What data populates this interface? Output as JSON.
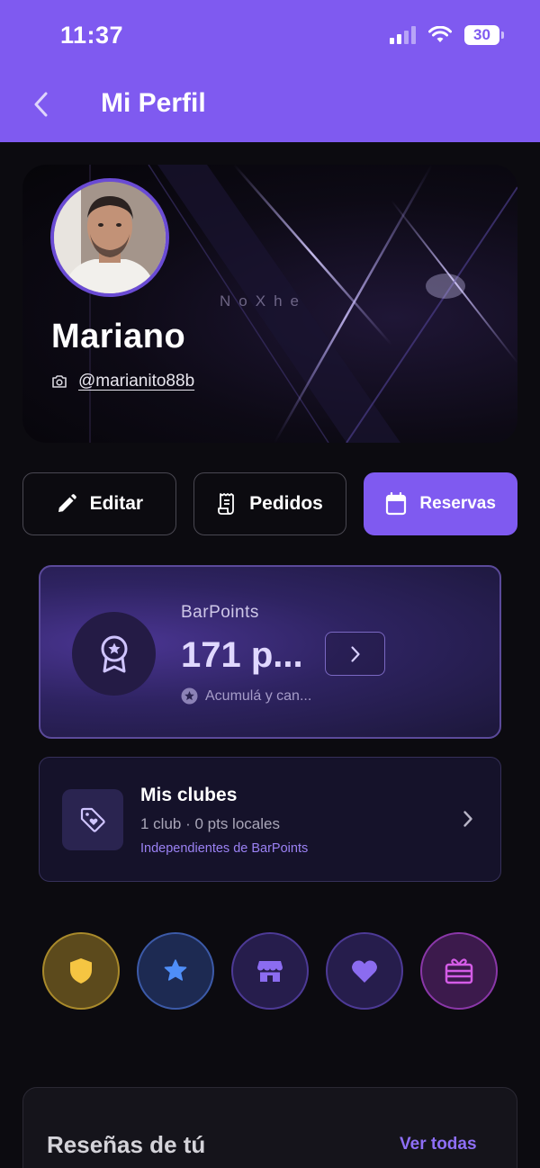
{
  "status_bar": {
    "time": "11:37",
    "battery": "30"
  },
  "header": {
    "title": "Mi Perfil",
    "back_icon": "chevron-left-icon"
  },
  "profile": {
    "name": "Mariano",
    "handle": "@marianito88b",
    "banner_wordmark": "NoXhe",
    "handle_icon": "camera-icon"
  },
  "actions": [
    {
      "label": "Editar",
      "icon": "pencil-icon"
    },
    {
      "label": "Pedidos",
      "icon": "receipt-icon"
    },
    {
      "label": "Reservas",
      "icon": "calendar-icon"
    }
  ],
  "barpoints": {
    "label": "BarPoints",
    "value": "171 p...",
    "hint": "Acumulá y can..."
  },
  "clubs": {
    "title": "Mis clubes",
    "subtitle": "1 club · 0 pts locales",
    "link": "Independientes de BarPoints"
  },
  "shortcuts": [
    {
      "icon": "shield-icon",
      "color": "#f5c542"
    },
    {
      "icon": "star-icon",
      "color": "#4f8ef7"
    },
    {
      "icon": "store-icon",
      "color": "#8b6cf0"
    },
    {
      "icon": "heart-icon",
      "color": "#8b6cf0"
    },
    {
      "icon": "gift-icon",
      "color": "#d45ce6"
    }
  ],
  "reviews": {
    "title": "Reseñas de tú",
    "link": "Ver todas"
  },
  "colors": {
    "accent": "#7f5af0",
    "background": "#0c0b10"
  }
}
